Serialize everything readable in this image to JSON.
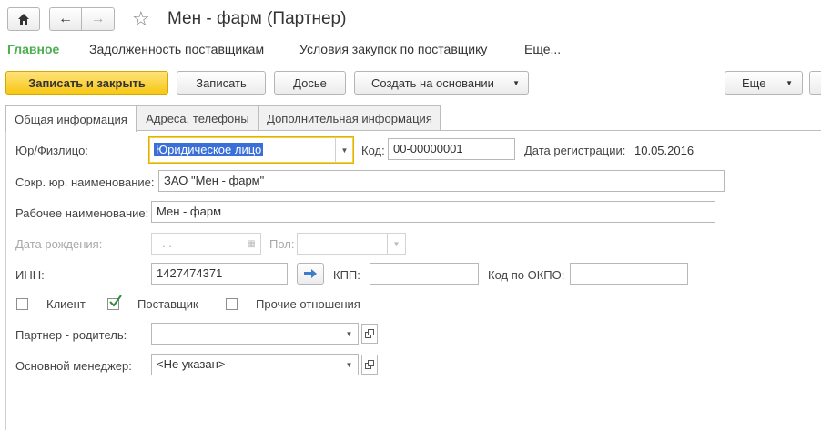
{
  "window": {
    "title": "Мен - фарм (Партнер)"
  },
  "nav": {
    "main": "Главное",
    "debt": "Задолженность поставщикам",
    "conditions": "Условия закупок по поставщику",
    "more": "Еще..."
  },
  "toolbar": {
    "save_close": "Записать и закрыть",
    "save": "Записать",
    "dossier": "Досье",
    "create_based": "Создать на основании",
    "more": "Еще"
  },
  "tabs": [
    "Общая информация",
    "Адреса, телефоны",
    "Дополнительная информация"
  ],
  "form": {
    "entity_type_label": "Юр/Физлицо:",
    "entity_type_value": "Юридическое лицо",
    "code_label": "Код:",
    "code_value": "00-00000001",
    "reg_date_label": "Дата регистрации:",
    "reg_date_value": "10.05.2016",
    "short_name_label": "Сокр. юр. наименование:",
    "short_name_value": "ЗАО \"Мен - фарм\"",
    "work_name_label": "Рабочее наименование:",
    "work_name_value": "Мен - фарм",
    "birth_date_label": "Дата рождения:",
    "birth_date_value": " .  .",
    "gender_label": "Пол:",
    "inn_label": "ИНН:",
    "inn_value": "1427474371",
    "kpp_label": "КПП:",
    "kpp_value": "",
    "okpo_label": "Код по ОКПО:",
    "okpo_value": "",
    "client_label": "Клиент",
    "client_checked": false,
    "supplier_label": "Поставщик",
    "supplier_checked": true,
    "other_label": "Прочие отношения",
    "other_checked": false,
    "parent_label": "Партнер - родитель:",
    "parent_value": "",
    "manager_label": "Основной менеджер:",
    "manager_value": "<Не указан>"
  },
  "colors": {
    "accent_green": "#4caf50",
    "primary_yellow": "#f7c815",
    "selection_blue": "#3a6fd8"
  }
}
